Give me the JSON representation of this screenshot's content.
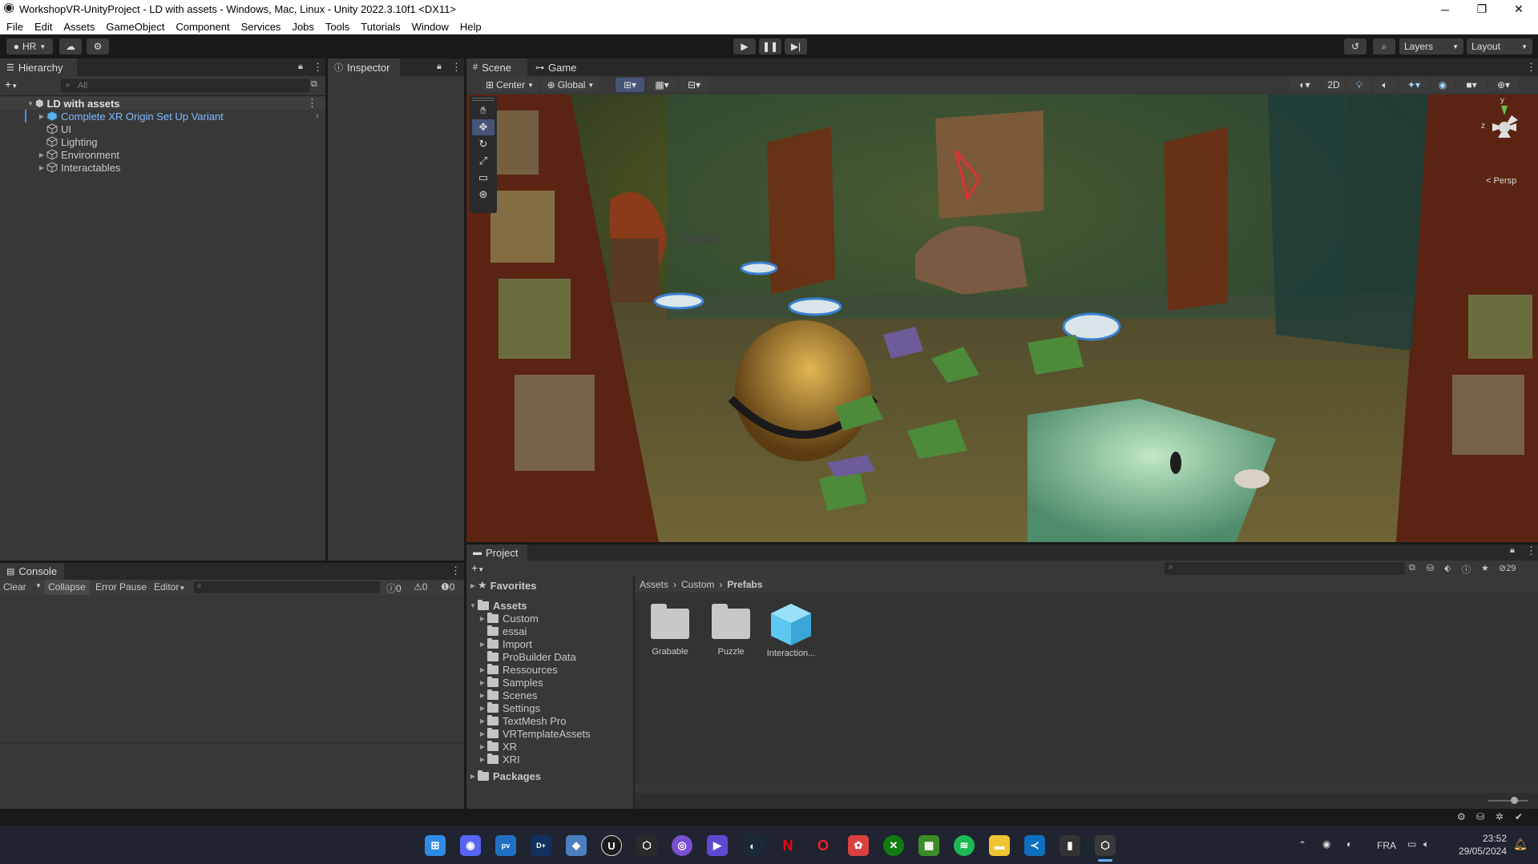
{
  "window": {
    "title": "WorkshopVR-UnityProject - LD with assets - Windows, Mac, Linux - Unity 2022.3.10f1 <DX11>",
    "minimize": "─",
    "maximize": "❐",
    "close": "✕"
  },
  "menu": [
    "File",
    "Edit",
    "Assets",
    "GameObject",
    "Component",
    "Services",
    "Jobs",
    "Tools",
    "Tutorials",
    "Window",
    "Help"
  ],
  "toolbar": {
    "account": "HR",
    "layers": "Layers",
    "layout": "Layout"
  },
  "hierarchy": {
    "tab": "Hierarchy",
    "search_placeholder": "All",
    "scene": "LD with assets",
    "items": [
      {
        "label": "Complete XR Origin Set Up Variant",
        "prefab": true,
        "expandable": true
      },
      {
        "label": "UI",
        "prefab": false,
        "expandable": false
      },
      {
        "label": "Lighting",
        "prefab": false,
        "expandable": false
      },
      {
        "label": "Environment",
        "prefab": false,
        "expandable": true
      },
      {
        "label": "Interactables",
        "prefab": false,
        "expandable": true
      }
    ]
  },
  "inspector": {
    "tab": "Inspector"
  },
  "scene_view": {
    "tab_scene": "Scene",
    "tab_game": "Game",
    "pivot": "Center",
    "space": "Global",
    "mode_2d": "2D",
    "projection": "Persp",
    "axis_y": "y",
    "axis_z": "z"
  },
  "console": {
    "tab": "Console",
    "clear": "Clear",
    "collapse": "Collapse",
    "error_pause": "Error Pause",
    "editor": "Editor",
    "log_count": "0",
    "warning_count": "0",
    "error_count": "0"
  },
  "project": {
    "tab": "Project",
    "favorites": "Favorites",
    "assets_root": "Assets",
    "folders": [
      {
        "label": "Custom",
        "expandable": true
      },
      {
        "label": "essai",
        "expandable": false
      },
      {
        "label": "Import",
        "expandable": true
      },
      {
        "label": "ProBuilder Data",
        "expandable": false
      },
      {
        "label": "Ressources",
        "expandable": true
      },
      {
        "label": "Samples",
        "expandable": true
      },
      {
        "label": "Scenes",
        "expandable": true
      },
      {
        "label": "Settings",
        "expandable": true
      },
      {
        "label": "TextMesh Pro",
        "expandable": true
      },
      {
        "label": "VRTemplateAssets",
        "expandable": true
      },
      {
        "label": "XR",
        "expandable": true
      },
      {
        "label": "XRI",
        "expandable": true
      }
    ],
    "packages": "Packages",
    "breadcrumb": [
      "Assets",
      "Custom",
      "Prefabs"
    ],
    "hidden_count": "29",
    "items": [
      {
        "label": "Grabable",
        "kind": "folder"
      },
      {
        "label": "Puzzle",
        "kind": "folder"
      },
      {
        "label": "Interaction...",
        "kind": "prefab"
      }
    ]
  },
  "taskbar": {
    "icons": [
      "windows-start",
      "discord",
      "prime-video",
      "disney-plus",
      "app-blue",
      "unreal",
      "unity-hub",
      "github",
      "app-purple",
      "steam",
      "netflix",
      "opera",
      "popcorn",
      "xbox",
      "minecraft",
      "spotify",
      "file-explorer",
      "vscode",
      "app-dark",
      "unity"
    ],
    "language": "FRA",
    "time": "23:52",
    "date": "29/05/2024"
  }
}
